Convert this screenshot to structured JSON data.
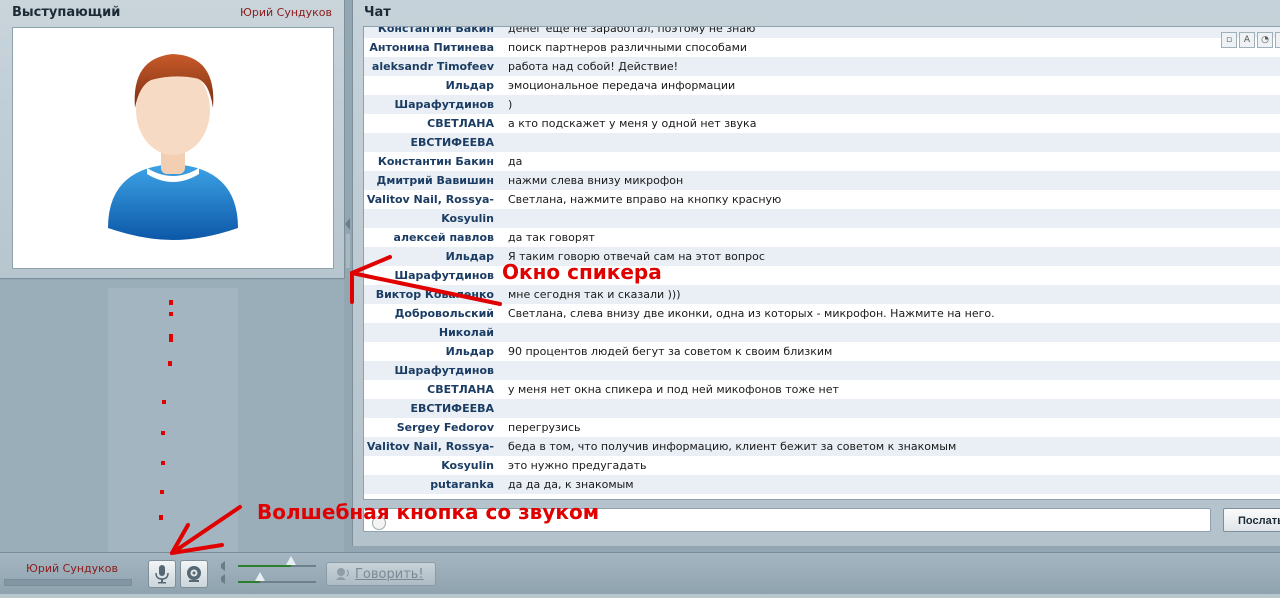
{
  "speaker_panel": {
    "title": "Выступающий",
    "speaker_name": "Юрий Сундуков"
  },
  "chat_panel": {
    "title": "Чат",
    "messages": [
      {
        "author": "Константин Бакин",
        "text": "денег еще не заработал, поэтому не знаю"
      },
      {
        "author": "Антонина Питинева",
        "text": "поиск партнеров различными способами"
      },
      {
        "author": "aleksandr Timofeev",
        "text": "работа над собой! Действие!"
      },
      {
        "author": "Ильдар",
        "text": "эмоциональное передача информации"
      },
      {
        "author": "Шарафутдинов",
        "text": ")"
      },
      {
        "author": "СВЕТЛАНА",
        "text": "а кто подскажет у меня у одной нет звука"
      },
      {
        "author": "ЕВСТИФЕЕВА",
        "text": ""
      },
      {
        "author": "Константин Бакин",
        "text": "да"
      },
      {
        "author": "Дмитрий Вавишин",
        "text": "нажми слева внизу микрофон"
      },
      {
        "author": "Valitov Nail, Rossya-",
        "text": "Светлана, нажмите вправо на кнопку красную"
      },
      {
        "author": "Kosyulin",
        "text": ""
      },
      {
        "author": "алексей павлов",
        "text": "да так говорят"
      },
      {
        "author": "Ильдар",
        "text": "Я таким говорю отвечай сам на этот вопрос"
      },
      {
        "author": "Шарафутдинов",
        "text": ""
      },
      {
        "author": "Виктор Коваленко",
        "text": "мне сегодня так и сказали )))"
      },
      {
        "author": "Добровольский",
        "text": "Светлана, слева внизу две иконки, одна из которых - микрофон. Нажмите на него."
      },
      {
        "author": "Николай",
        "text": ""
      },
      {
        "author": "Ильдар",
        "text": "90 процентов людей бегут за советом к своим близким"
      },
      {
        "author": "Шарафутдинов",
        "text": ""
      },
      {
        "author": "СВЕТЛАНА",
        "text": "у меня нет окна спикера и под ней микофонов тоже нет"
      },
      {
        "author": "ЕВСТИФЕЕВА",
        "text": ""
      },
      {
        "author": "Sergey Fedorov",
        "text": "перегрузись"
      },
      {
        "author": "Valitov Nail, Rossya-",
        "text": "беда в том, что получив информацию, клиент бежит за советом к знакомым"
      },
      {
        "author": "Kosyulin",
        "text": "это нужно предугадать"
      },
      {
        "author": "putaranka",
        "text": "да да да, к знакомым"
      }
    ],
    "send_label": "Послать"
  },
  "bottom_bar": {
    "user_name": "Юрий Сундуков",
    "talk_label": "Говорить!",
    "volume_level": 0.68,
    "mic_level": 0.28
  },
  "annotations": {
    "speaker_window": "Окно спикера",
    "magic_button": "Волшебная кнопка со звуком"
  },
  "colors": {
    "annotation": "#e00000",
    "speaker_name": "#8a1a1a",
    "chat_author": "#1b3c63"
  }
}
